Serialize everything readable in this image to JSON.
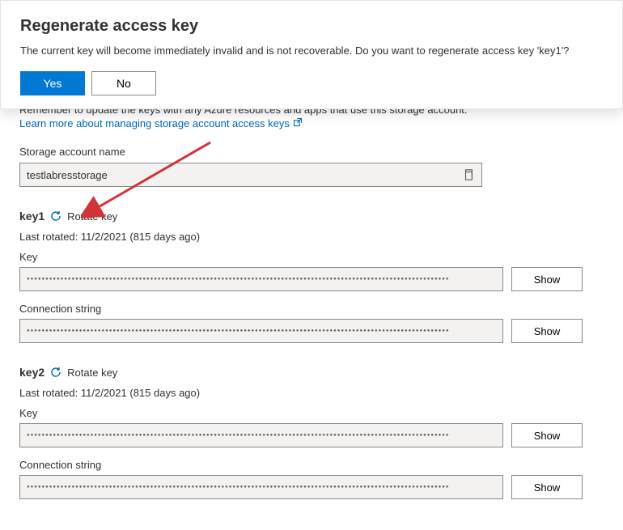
{
  "modal": {
    "title": "Regenerate access key",
    "text": "The current key will become immediately invalid and is not recoverable. Do you want to regenerate access key 'key1'?",
    "yes": "Yes",
    "no": "No"
  },
  "info": {
    "reminder": "Remember to update the keys with any Azure resources and apps that use this storage account.",
    "learn_more": "Learn more about managing storage account access keys"
  },
  "storage": {
    "label": "Storage account name",
    "value": "testlabresstorage"
  },
  "keys": [
    {
      "name": "key1",
      "rotate_label": "Rotate key",
      "last_rotated": "Last rotated: 11/2/2021 (815 days ago)",
      "key_label": "Key",
      "conn_label": "Connection string",
      "show": "Show"
    },
    {
      "name": "key2",
      "rotate_label": "Rotate key",
      "last_rotated": "Last rotated: 11/2/2021 (815 days ago)",
      "key_label": "Key",
      "conn_label": "Connection string",
      "show": "Show"
    }
  ],
  "masked": "●●●●●●●●●●●●●●●●●●●●●●●●●●●●●●●●●●●●●●●●●●●●●●●●●●●●●●●●●●●●●●●●●●●●●●●●●●●●●●●●●●●●●●●●●●●●●●●●●●●●●●●●●●●●●●●●●"
}
